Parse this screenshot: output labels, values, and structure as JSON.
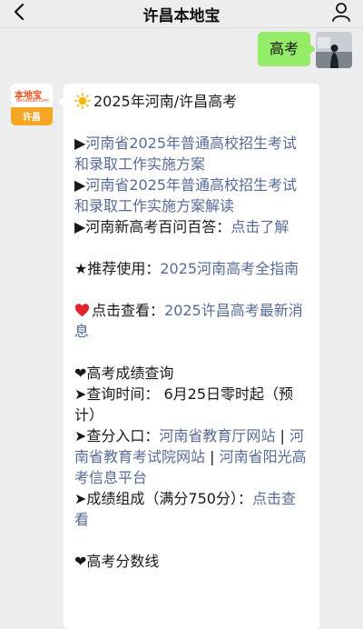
{
  "header": {
    "title": "许昌本地宝",
    "back_icon": "back-chevron-icon",
    "user_icon": "user-profile-icon"
  },
  "outgoing": {
    "text": "高考"
  },
  "bot": {
    "avatar_logo_line1": "本地宝",
    "avatar_logo_line2": "Bendibao.com",
    "avatar_logo_line3": "许昌"
  },
  "message": {
    "title": "2025年河南/许昌高考",
    "items1": [
      {
        "prefix": "▶",
        "text": "河南省2025年普通高校招生考试和录取工作实施方案",
        "is_link": true
      },
      {
        "prefix": "▶",
        "text": "河南省2025年普通高校招生考试和录取工作实施方案解读",
        "is_link": true
      }
    ],
    "qa_prefix": "▶河南新高考百问百答：",
    "qa_link": "点击了解",
    "recommend_prefix": "★推荐使用：",
    "recommend_link": "2025河南高考全指南",
    "view_prefix": "点击查看：",
    "view_link": "2025许昌高考最新消息",
    "score_heading": "❤高考成绩查询",
    "query_time_label": "➤查询时间： 6月25日零时起（预计）",
    "entry_label": "➤查分入口：",
    "entry_link1": "河南省教育厅网站",
    "sep": " | ",
    "entry_link2": "河南省教育考试院网站",
    "entry_link3": "河南省阳光高考信息平台",
    "composition_label": "➤成绩组成（满分750分）：",
    "composition_link": "点击查看",
    "cutoff_heading": "❤高考分数线"
  }
}
